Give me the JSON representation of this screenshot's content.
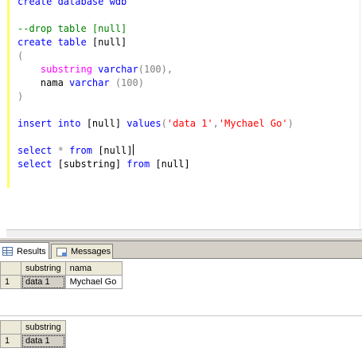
{
  "editor": {
    "lines": [
      [
        {
          "t": "create database wdb",
          "c": "kw"
        }
      ],
      [
        {
          "t": "",
          "c": ""
        }
      ],
      [
        {
          "t": "--drop table [null]",
          "c": "cm"
        }
      ],
      [
        {
          "t": "create table",
          "c": "kw"
        },
        {
          "t": " [null]",
          "c": ""
        }
      ],
      [
        {
          "t": "(",
          "c": "gr"
        }
      ],
      [
        {
          "t": "    ",
          "c": ""
        },
        {
          "t": "substring",
          "c": "fn"
        },
        {
          "t": " ",
          "c": ""
        },
        {
          "t": "varchar",
          "c": "kw"
        },
        {
          "t": "(100),",
          "c": "gr"
        }
      ],
      [
        {
          "t": "    nama ",
          "c": ""
        },
        {
          "t": "varchar",
          "c": "kw"
        },
        {
          "t": " (100)",
          "c": "gr"
        }
      ],
      [
        {
          "t": ")",
          "c": "gr"
        }
      ],
      [
        {
          "t": "",
          "c": ""
        }
      ],
      [
        {
          "t": "insert into",
          "c": "kw"
        },
        {
          "t": " [null] ",
          "c": ""
        },
        {
          "t": "values",
          "c": "kw"
        },
        {
          "t": "(",
          "c": "gr"
        },
        {
          "t": "'data 1'",
          "c": "st"
        },
        {
          "t": ",",
          "c": "gr"
        },
        {
          "t": "'Mychael Go'",
          "c": "st"
        },
        {
          "t": ")",
          "c": "gr"
        }
      ],
      [
        {
          "t": "",
          "c": ""
        }
      ],
      [
        {
          "t": "select",
          "c": "kw"
        },
        {
          "t": " ",
          "c": ""
        },
        {
          "t": "*",
          "c": "gr"
        },
        {
          "t": " ",
          "c": ""
        },
        {
          "t": "from",
          "c": "kw"
        },
        {
          "t": " [null]",
          "c": ""
        },
        {
          "t": "|caret|",
          "c": "caret"
        }
      ],
      [
        {
          "t": "select",
          "c": "kw"
        },
        {
          "t": " [substring] ",
          "c": ""
        },
        {
          "t": "from",
          "c": "kw"
        },
        {
          "t": " [null]",
          "c": ""
        }
      ]
    ]
  },
  "tabs": {
    "results_label": "Results",
    "messages_label": "Messages"
  },
  "results": {
    "grid1": {
      "columns": [
        "substring",
        "nama"
      ],
      "rows": [
        {
          "num": "1",
          "cells": [
            "data 1",
            "Mychael Go"
          ]
        }
      ]
    },
    "grid2": {
      "columns": [
        "substring"
      ],
      "rows": [
        {
          "num": "1",
          "cells": [
            "data 1"
          ]
        }
      ]
    }
  }
}
